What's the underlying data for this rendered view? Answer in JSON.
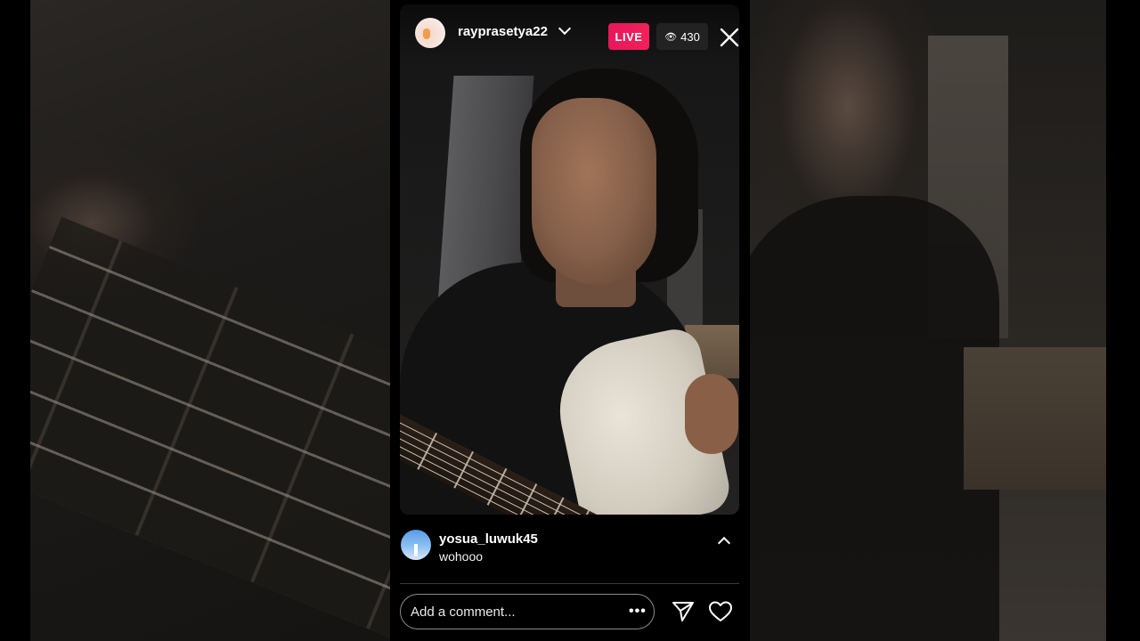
{
  "live": {
    "username": "rayprasetya22",
    "live_label": "LIVE",
    "viewer_count": "430"
  },
  "comment": {
    "username": "yosua_luwuk45",
    "text": "wohooo"
  },
  "composer": {
    "placeholder": "Add a comment..."
  },
  "icons": {
    "account_menu": "chevron-down-icon",
    "viewers": "eye-icon",
    "close": "close-icon",
    "expand": "chevron-up-icon",
    "more": "more-icon",
    "send": "send-icon",
    "like": "heart-icon"
  },
  "colors": {
    "live_badge": "#e8175d",
    "background": "#000000"
  }
}
